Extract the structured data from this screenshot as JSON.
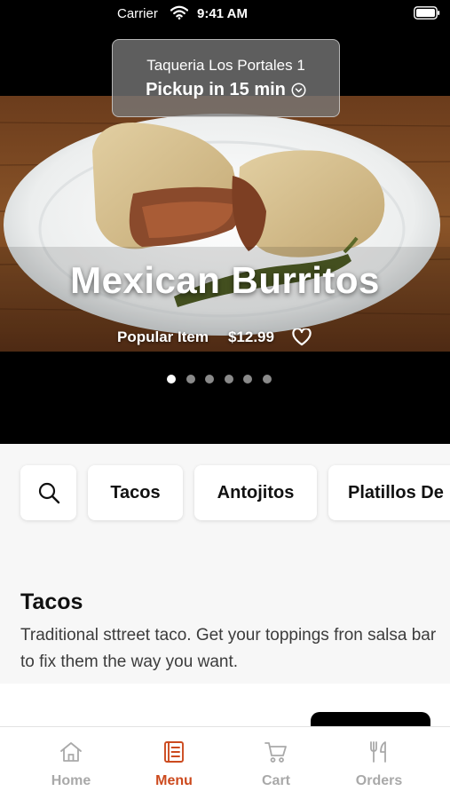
{
  "status_bar": {
    "carrier": "Carrier",
    "time": "9:41 AM"
  },
  "location": {
    "name": "Taqueria Los Portales 1",
    "pickup": "Pickup in 15 min"
  },
  "hero": {
    "title": "Mexican Burritos",
    "tag": "Popular Item",
    "price": "$12.99",
    "slides": 6,
    "active_slide": 1
  },
  "categories": {
    "items": [
      "Tacos",
      "Antojitos",
      "Platillos De"
    ]
  },
  "section": {
    "title": "Tacos",
    "description": "Traditional sttreet taco. Get your toppings fron salsa bar to fix them the way you want."
  },
  "tabs": [
    {
      "label": "Home",
      "icon": "home-icon"
    },
    {
      "label": "Menu",
      "icon": "menu-icon"
    },
    {
      "label": "Cart",
      "icon": "cart-icon"
    },
    {
      "label": "Orders",
      "icon": "orders-icon"
    }
  ],
  "active_tab": "Menu",
  "colors": {
    "accent": "#cc4a1e",
    "inactive": "#a9a9a9"
  }
}
